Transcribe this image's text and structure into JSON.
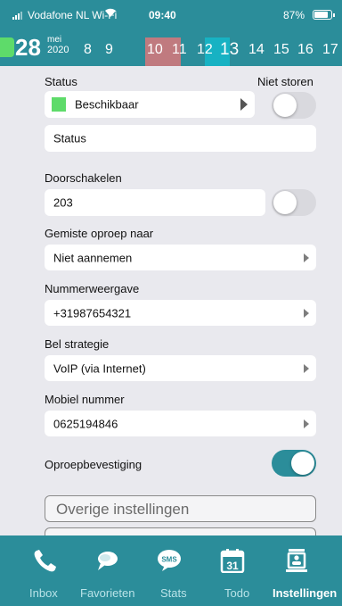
{
  "status_bar": {
    "carrier": "Vodafone NL Wi-Fi",
    "wifi_icon": "wifi-icon",
    "time": "09:40",
    "battery": "87%"
  },
  "date_strip": {
    "day": "28",
    "month": "mei",
    "year": "2020",
    "days": [
      "8",
      "9",
      "10",
      "11",
      "12",
      "13",
      "14",
      "15",
      "16",
      "17"
    ]
  },
  "form": {
    "status_label": "Status",
    "dnd_label": "Niet storen",
    "availability": "Beschikbaar",
    "status_placeholder": "Status",
    "forward_label": "Doorschakelen",
    "forward_value": "203",
    "missed_label": "Gemiste oproep naar",
    "missed_value": "Niet aannemen",
    "number_display_label": "Nummerweergave",
    "number_display_value": "+31987654321",
    "call_strategy_label": "Bel strategie",
    "call_strategy_value": "VoIP (via Internet)",
    "mobile_label": "Mobiel nummer",
    "mobile_value": "0625194846",
    "confirm_label": "Oproepbevestiging",
    "other_settings": "Overige instellingen"
  },
  "toggles": {
    "dnd": false,
    "forward": false,
    "confirm": true
  },
  "tabs": [
    {
      "label": "Inbox",
      "icon": "phone-icon"
    },
    {
      "label": "Favorieten",
      "icon": "chat-icon"
    },
    {
      "label": "Stats",
      "icon": "sms-icon"
    },
    {
      "label": "Todo",
      "icon": "calendar-icon"
    },
    {
      "label": "Instellingen",
      "icon": "settings-icon",
      "active": true
    }
  ],
  "calendar_icon_day": "31",
  "sms_icon_text": "SMS",
  "colors": {
    "accent": "#2b8d9a",
    "available": "#5edb6a",
    "today_highlight": "#c07a7f",
    "selected_highlight": "#17b2c3"
  }
}
